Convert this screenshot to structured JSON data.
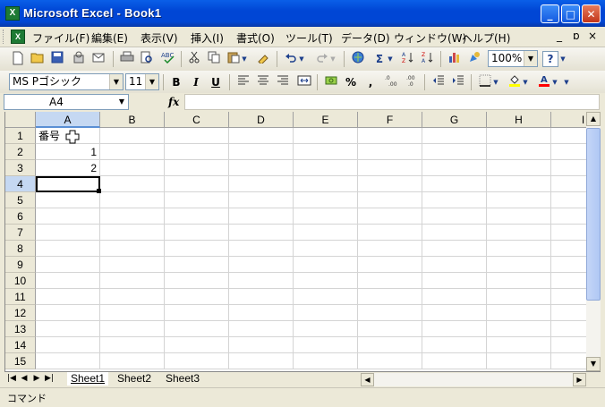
{
  "window": {
    "title": "Microsoft Excel - Book1",
    "app_icon": "excel-icon",
    "app_icon_glyph": "X",
    "min_glyph": "_",
    "max_glyph": "□",
    "close_glyph": "✕"
  },
  "menubar": {
    "items": [
      {
        "label": "ファイル(F)"
      },
      {
        "label": "編集(E)"
      },
      {
        "label": "表示(V)"
      },
      {
        "label": "挿入(I)"
      },
      {
        "label": "書式(O)"
      },
      {
        "label": "ツール(T)"
      },
      {
        "label": "データ(D)"
      },
      {
        "label": "ウィンドウ(W)"
      },
      {
        "label": "ヘルプ(H)"
      }
    ],
    "doc_min": "_",
    "doc_restore": "ɒ",
    "doc_close": "×"
  },
  "standard_toolbar": {
    "zoom": "100%",
    "sigma": "Σ",
    "help_glyph": "?"
  },
  "format_toolbar": {
    "font": "MS Pゴシック",
    "size": "11",
    "bold": "B",
    "italic": "I",
    "underline": "U",
    "percent": "%",
    "comma": ","
  },
  "formula_bar": {
    "name_box": "A4",
    "fx": "fx",
    "value": ""
  },
  "sheet": {
    "columns": [
      "A",
      "B",
      "C",
      "D",
      "E",
      "F",
      "G",
      "H",
      "I"
    ],
    "rows": [
      "1",
      "2",
      "3",
      "4",
      "5",
      "6",
      "7",
      "8",
      "9",
      "10",
      "11",
      "12",
      "13",
      "14",
      "15"
    ],
    "active_column": "A",
    "active_row": "4",
    "cells": {
      "A1": "番号",
      "A2": "1",
      "A3": "2"
    }
  },
  "sheet_tabs": {
    "tabs": [
      "Sheet1",
      "Sheet2",
      "Sheet3"
    ],
    "active": "Sheet1"
  },
  "status": {
    "text": "コマンド"
  }
}
